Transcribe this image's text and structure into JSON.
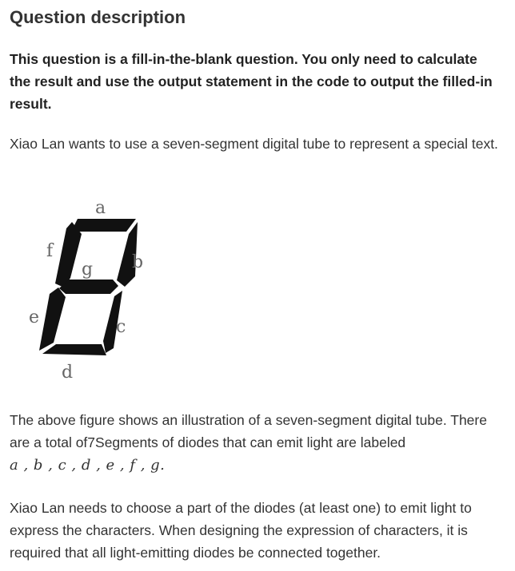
{
  "heading": "Question description",
  "note": "This question is a fill-in-the-blank question. You only need to calculate the result and use the output statement in the code to output the filled-in result.",
  "intro": "Xiao Lan wants to use a seven-segment digital tube to represent a special text.",
  "figure": {
    "segments": [
      {
        "id": "a",
        "label": "a"
      },
      {
        "id": "b",
        "label": "b"
      },
      {
        "id": "c",
        "label": "c"
      },
      {
        "id": "d",
        "label": "d"
      },
      {
        "id": "e",
        "label": "e"
      },
      {
        "id": "f",
        "label": "f"
      },
      {
        "id": "g",
        "label": "g"
      }
    ],
    "segment_color": "#111111",
    "label_color": "#666666"
  },
  "description": {
    "text": "The above figure shows an illustration of a seven-segment digital tube. There are a total of7Segments of diodes that can emit light are labeled",
    "labels_math": "a , b , c , d , e , f , g."
  },
  "requirement": "Xiao Lan needs to choose a part of the diodes (at least one) to emit light to express the characters. When designing the expression of characters, it is required that all light-emitting diodes be connected together."
}
